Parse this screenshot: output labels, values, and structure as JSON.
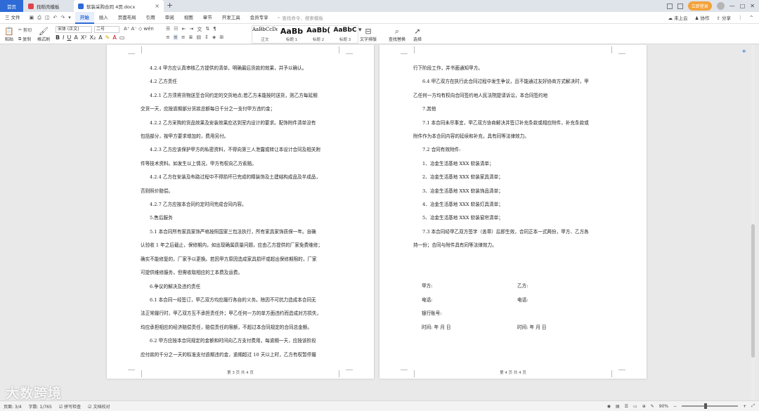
{
  "tabs": {
    "home": "首页",
    "template": "找稻壳模板",
    "doc": "软装采购合同 4页.docx",
    "add": "+"
  },
  "topbar": {
    "login": "立即登录",
    "controls": [
      "—",
      "□",
      "✕"
    ]
  },
  "menu": {
    "file": "三 文件",
    "items": [
      "开始",
      "插入",
      "页面布局",
      "引用",
      "审阅",
      "视图",
      "章节",
      "开发工具",
      "会员专享"
    ],
    "active": "开始",
    "search_placeholder": "查找命令、搜索模板",
    "cloud": "未上云",
    "collab": "协作",
    "share": "分享"
  },
  "ribbon": {
    "paste": "粘贴",
    "cut": "剪切",
    "copy": "复制",
    "format_painter": "格式刷",
    "font_name": "宋体 (正文)",
    "font_size": "二号",
    "styles": [
      {
        "preview": "AaBbCcDd",
        "name": "正文"
      },
      {
        "preview": "AaBb",
        "name": "标题 1"
      },
      {
        "preview": "AaBb(",
        "name": "标题 2"
      },
      {
        "preview": "AaBbC",
        "name": "标题 3"
      }
    ],
    "text_layout": "文字排版",
    "find_replace": "查找替换",
    "select": "选择"
  },
  "page3": {
    "lines": [
      {
        "t": "4.2.4 甲方应认真审核乙方提供的清单，明确最后货款的效果，并予以确认。",
        "i": true
      },
      {
        "t": "4.2 乙方责任",
        "i": true
      },
      {
        "t": "4.2.1 乙方须将货物送至合同约定的交货地点;若乙方未能按时送货，则乙方每延期",
        "i": true
      },
      {
        "t": "交货一天，应按逾期部分货款总额每日千分之一支付甲方违约金；",
        "i": false
      },
      {
        "t": "4.2.2 乙方采购的货品效果及安装效果应达到室内设计的要求。配饰附件清单没有",
        "i": true
      },
      {
        "t": "包括部分，按甲方要求增加的，费用另付。",
        "i": false
      },
      {
        "t": "4.2.3 乙方应该保护甲方的私密资料，不得向第三人泄露或转让本设计合同及相关附",
        "i": true
      },
      {
        "t": "件等技术资料。如发生以上情况，甲方有权向乙方索赔。",
        "i": false
      },
      {
        "t": "4.2.4 乙方在安装及布路过程中不得损坏已完成的精装饰及土建结构成品及半成品，",
        "i": true
      },
      {
        "t": "否则照价赔偿。",
        "i": false
      },
      {
        "t": "4.2.7 乙方应按本合同约定时间完成合同内容。",
        "i": true
      },
      {
        "t": "5.售后服务",
        "i": true
      },
      {
        "t": "5.1 本合同所有家具家饰严格按照国家三包法执行，所有家具家饰质保一年。自确",
        "i": true
      },
      {
        "t": "认验收 1 年之后截止，保修期内，如出现确属质量问题，应由乙方提供的厂家免费维修；",
        "i": false
      },
      {
        "t": "确实不能修复的，厂家予以更换。若因甲方原因造成家具损坏或超出保修期限的，厂家",
        "i": false
      },
      {
        "t": "可提供维修服务，但需收取相应的工本费及运费。",
        "i": false
      },
      {
        "t": "6.争议的解决及违约责任",
        "i": true
      },
      {
        "t": "6.1 本合同一经签订，甲乙双方均应履行各自的义务。除因不可抗力造成本合同无",
        "i": true
      },
      {
        "t": "法正常履行时，甲乙双方互不承担责任外；甲乙任何一方的单方面违约而造成对方损失，",
        "i": false
      },
      {
        "t": "均应承担相应的经济赔偿责任，赔偿责任的限额，不超过本合同规定的合同总金额。",
        "i": false
      },
      {
        "t": "6.2 甲方应按本合同规定的金额和时间向乙方支付费用，每逾期一天，应按该阶段",
        "i": true
      },
      {
        "t": "应付款的千分之一天的标准支付逾期违约金，逾期超过 10 天以上时，乙方有权暂停履",
        "i": false
      }
    ],
    "footer": "第 3 页 共 4 页"
  },
  "page4": {
    "lines": [
      {
        "t": "行下阶段工作，并书面通知甲方。",
        "i": false
      },
      {
        "t": "6.4 甲乙双方在执行此合同过程中发生争议，且不能通过友好协商方式解决时，甲",
        "i": true
      },
      {
        "t": "乙任何一方均有权向合同签约地人民法院提请诉讼，本合同签约地",
        "i": false
      },
      {
        "t": "7.其他",
        "i": true
      },
      {
        "t": "7.1 本合同未尽事宜，甲乙双方协商解决并签订补充条款或相应附件，补充条款或",
        "i": true
      },
      {
        "t": "附件作为本合同内容的延续和补充，具有同等法律效力。",
        "i": false
      },
      {
        "t": "7.2 合同有效附件:",
        "i": true
      },
      {
        "t": "1、冶金生活基地 XXX 软装清单；",
        "i": true
      },
      {
        "t": "2、冶金生活基地 XXX 软装家具清单；",
        "i": true
      },
      {
        "t": "3、冶金生活基地 XXX 软装饰品清单；",
        "i": true
      },
      {
        "t": "4、冶金生活基地 XXX 软装灯具清单；",
        "i": true
      },
      {
        "t": "5、冶金生活基地 XXX 软装窗帘清单；",
        "i": true
      },
      {
        "t": "7.3 本合同经甲乙双方签字（盖章）后即生效，合同正本一式两份，甲方、乙方各",
        "i": true
      },
      {
        "t": "持一份；合同与附件具有同等法律效力。",
        "i": false
      }
    ],
    "signature": {
      "party_a": "甲方:",
      "party_b": "乙方:",
      "phone_a": "电话:",
      "phone_b": "电话:",
      "bank": "银行账号:",
      "date_a": "时间:          年          月          日",
      "date_b": "时间:          年          月          日"
    },
    "footer": "第 4 页 共 4 页"
  },
  "status": {
    "page": "页面: 3/4",
    "words": "字数: 1/765",
    "spell": "拼写检查",
    "proof": "文档校对",
    "zoom": "90%",
    "zoom_value": 0.9
  },
  "watermark": "大数跨境",
  "colors": {
    "accent": "#2e6bd6",
    "login": "#f3a23a"
  }
}
